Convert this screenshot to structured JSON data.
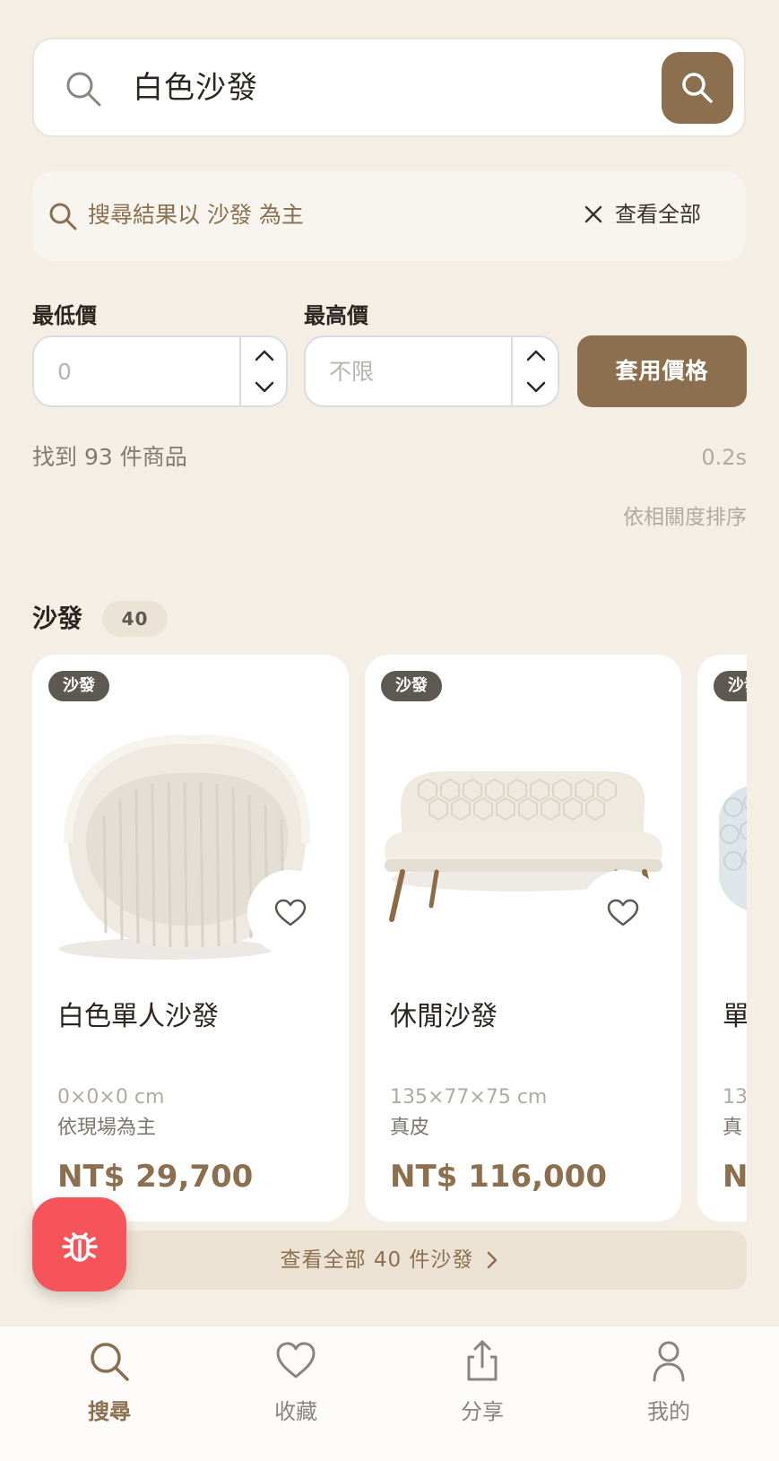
{
  "search": {
    "query": "白色沙發",
    "icon": "search-icon",
    "submit_icon": "search-icon"
  },
  "notice": {
    "text": "搜尋結果以 沙發 為主",
    "clear_label": "查看全部"
  },
  "price_filter": {
    "min_label": "最低價",
    "min_value": "0",
    "max_label": "最高價",
    "max_placeholder": "不限",
    "apply_label": "套用價格"
  },
  "results": {
    "count_text": "找到 93 件商品",
    "timing": "0.2s",
    "sort_label": "依相關度排序"
  },
  "section": {
    "title": "沙發",
    "count": "40",
    "view_all_label": "查看全部 40 件沙發"
  },
  "products": [
    {
      "tag": "沙發",
      "name": "白色單人沙發",
      "dimensions": "0×0×0 cm",
      "material": "依現場為主",
      "price": "NT$ 29,700"
    },
    {
      "tag": "沙發",
      "name": "休閒沙發",
      "dimensions": "135×77×75 cm",
      "material": "真皮",
      "price": "NT$ 116,000"
    },
    {
      "tag": "沙發",
      "name": "單",
      "dimensions": "13",
      "material": "真",
      "price": "NT"
    }
  ],
  "tabbar": [
    {
      "label": "搜尋",
      "icon": "search-icon",
      "active": true
    },
    {
      "label": "收藏",
      "icon": "heart-icon",
      "active": false
    },
    {
      "label": "分享",
      "icon": "share-icon",
      "active": false
    },
    {
      "label": "我的",
      "icon": "user-icon",
      "active": false
    }
  ],
  "colors": {
    "accent": "#8b6f4e",
    "background": "#f4eee5",
    "fab": "#f5545a"
  }
}
